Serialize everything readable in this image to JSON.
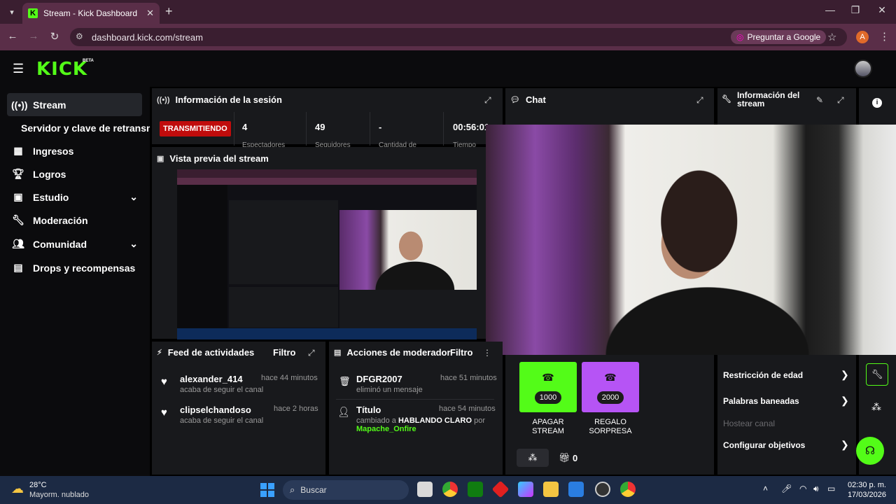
{
  "browser": {
    "tab_title": "Stream - Kick Dashboard",
    "tab_favicon": "K",
    "url": "dashboard.kick.com/stream",
    "ask_google": "Preguntar a Google",
    "profile_initial": "A"
  },
  "header": {
    "logo": "KICK",
    "beta": "BETA"
  },
  "sidebar": {
    "items": [
      {
        "label": "Stream",
        "icon": "broadcast-icon"
      },
      {
        "label": "Servidor y clave de retransm"
      },
      {
        "label": "Ingresos",
        "icon": "chart-icon"
      },
      {
        "label": "Logros",
        "icon": "trophy-icon"
      },
      {
        "label": "Estudio",
        "icon": "studio-icon"
      },
      {
        "label": "Moderación",
        "icon": "wrench-icon"
      },
      {
        "label": "Comunidad",
        "icon": "community-icon"
      },
      {
        "label": "Drops y recompensas",
        "icon": "drops-icon"
      }
    ]
  },
  "session": {
    "title": "Información de la sesión",
    "status": "TRANSMITIENDO",
    "stats": [
      {
        "value": "4",
        "label": "Espectadores"
      },
      {
        "value": "49",
        "label": "Seguidores"
      },
      {
        "value": "-",
        "label": "Cantidad de"
      },
      {
        "value": "00:56:01",
        "label": "Tiempo"
      }
    ]
  },
  "chat": {
    "title": "Chat"
  },
  "stream_info": {
    "title_line1": "Información del",
    "title_line2": "stream",
    "stream_title": "HABLANDO CLARO"
  },
  "preview": {
    "title": "Vista previa del stream"
  },
  "activity_feed": {
    "title": "Feed de actividades",
    "filter": "Filtro",
    "items": [
      {
        "name": "alexander_414",
        "desc": "acaba de seguir el canal",
        "time": "hace 44 minutos"
      },
      {
        "name": "clipselchandoso",
        "desc": "acaba de seguir el canal",
        "time": "hace 2 horas"
      }
    ]
  },
  "mod_actions": {
    "title": "Acciones de moderador",
    "filter": "Filtro",
    "items": [
      {
        "name": "DFGR2007",
        "desc": "eliminó un mensaje",
        "time": "hace 51 minutos"
      },
      {
        "name": "Título",
        "desc_prefix": "cambiado a",
        "desc_value": "HABLANDO CLARO",
        "desc_by": "por",
        "desc_user": "Mapache_Onfire",
        "time": "hace 54 minutos"
      }
    ]
  },
  "rewards": {
    "items": [
      {
        "cost": "1000",
        "label_line1": "APAGAR",
        "label_line2": "STREAM",
        "color": "#53fc18"
      },
      {
        "cost": "2000",
        "label_line1": "REGALO",
        "label_line2": "SORPRESA",
        "color": "#b654f5"
      }
    ],
    "gift_count": "0"
  },
  "settings": {
    "items": [
      {
        "label": "Restricción de edad",
        "enabled": true
      },
      {
        "label": "Palabras baneadas",
        "enabled": true
      },
      {
        "label": "Hostear canal",
        "enabled": false
      },
      {
        "label": "Configurar objetivos",
        "enabled": true
      }
    ]
  },
  "taskbar": {
    "temp": "28°C",
    "weather": "Mayorm. nublado",
    "search": "Buscar",
    "time": "02:30 p. m.",
    "date": "17/03/2026"
  },
  "colors": {
    "accent": "#53fc18",
    "live": "#c00c0c",
    "purple": "#b654f5"
  }
}
